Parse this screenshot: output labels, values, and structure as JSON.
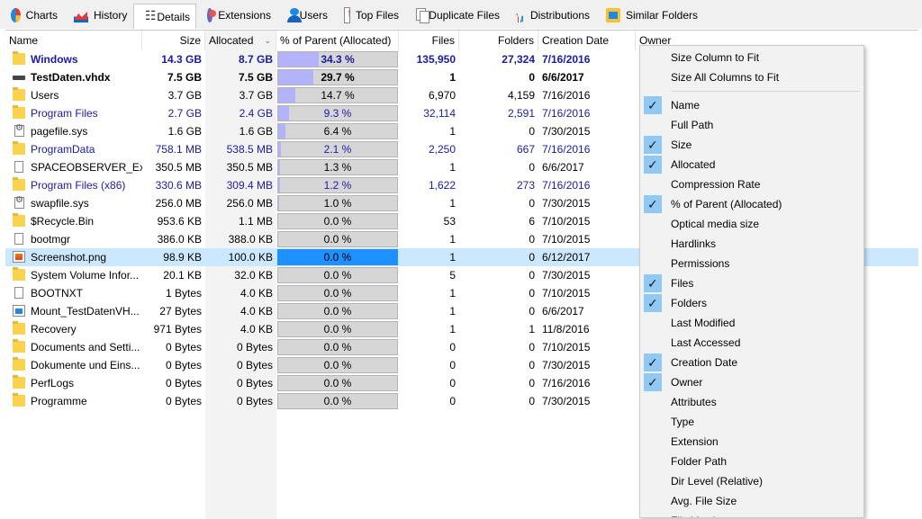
{
  "tabs": [
    {
      "label": "Charts",
      "icon": "pie-chart-icon"
    },
    {
      "label": "History",
      "icon": "history-chart-icon"
    },
    {
      "label": "Details",
      "icon": "details-list-icon",
      "active": true
    },
    {
      "label": "Extensions",
      "icon": "extensions-icon"
    },
    {
      "label": "Users",
      "icon": "users-icon"
    },
    {
      "label": "Top Files",
      "icon": "top-files-icon"
    },
    {
      "label": "Duplicate Files",
      "icon": "duplicate-files-icon"
    },
    {
      "label": "Distributions",
      "icon": "distributions-icon"
    },
    {
      "label": "Similar Folders",
      "icon": "similar-folders-icon"
    }
  ],
  "columns": {
    "name": "Name",
    "size": "Size",
    "allocated": "Allocated",
    "pct": "% of Parent (Allocated)",
    "files": "Files",
    "folders": "Folders",
    "creation": "Creation Date",
    "owner": "Owner"
  },
  "rows": [
    {
      "name": "Windows",
      "size": "14.3 GB",
      "allocated": "8.7 GB",
      "pct": "34.3 %",
      "pct_value": 34.3,
      "files": "135,950",
      "folders": "27,324",
      "creation": "7/16/2016",
      "icon": "folder",
      "style": "bold-blue"
    },
    {
      "name": "TestDaten.vhdx",
      "size": "7.5 GB",
      "allocated": "7.5 GB",
      "pct": "29.7 %",
      "pct_value": 29.7,
      "files": "1",
      "folders": "0",
      "creation": "6/6/2017",
      "icon": "drive",
      "style": "bold"
    },
    {
      "name": "Users",
      "size": "3.7 GB",
      "allocated": "3.7 GB",
      "pct": "14.7 %",
      "pct_value": 14.7,
      "files": "6,970",
      "folders": "4,159",
      "creation": "7/16/2016",
      "icon": "folder",
      "style": "normal"
    },
    {
      "name": "Program Files",
      "size": "2.7 GB",
      "allocated": "2.4 GB",
      "pct": "9.3 %",
      "pct_value": 9.3,
      "files": "32,114",
      "folders": "2,591",
      "creation": "7/16/2016",
      "icon": "folder",
      "style": "blue"
    },
    {
      "name": "pagefile.sys",
      "size": "1.6 GB",
      "allocated": "1.6 GB",
      "pct": "6.4 %",
      "pct_value": 6.4,
      "files": "1",
      "folders": "0",
      "creation": "7/30/2015",
      "icon": "gear",
      "style": "normal"
    },
    {
      "name": "ProgramData",
      "size": "758.1 MB",
      "allocated": "538.5 MB",
      "pct": "2.1 %",
      "pct_value": 2.1,
      "files": "2,250",
      "folders": "667",
      "creation": "7/16/2016",
      "icon": "folder",
      "style": "blue"
    },
    {
      "name": "SPACEOBSERVER_Ex...",
      "size": "350.5 MB",
      "allocated": "350.5 MB",
      "pct": "1.3 %",
      "pct_value": 1.3,
      "files": "1",
      "folders": "0",
      "creation": "6/6/2017",
      "icon": "file",
      "style": "normal"
    },
    {
      "name": "Program Files (x86)",
      "size": "330.6 MB",
      "allocated": "309.4 MB",
      "pct": "1.2 %",
      "pct_value": 1.2,
      "files": "1,622",
      "folders": "273",
      "creation": "7/16/2016",
      "icon": "folder",
      "style": "blue"
    },
    {
      "name": "swapfile.sys",
      "size": "256.0 MB",
      "allocated": "256.0 MB",
      "pct": "1.0 %",
      "pct_value": 1.0,
      "files": "1",
      "folders": "0",
      "creation": "7/30/2015",
      "icon": "gear",
      "style": "normal"
    },
    {
      "name": "$Recycle.Bin",
      "size": "953.6 KB",
      "allocated": "1.1 MB",
      "pct": "0.0 %",
      "pct_value": 0,
      "files": "53",
      "folders": "6",
      "creation": "7/10/2015",
      "icon": "folder",
      "style": "normal"
    },
    {
      "name": "bootmgr",
      "size": "386.0 KB",
      "allocated": "388.0 KB",
      "pct": "0.0 %",
      "pct_value": 0,
      "files": "1",
      "folders": "0",
      "creation": "7/10/2015",
      "icon": "file",
      "style": "normal"
    },
    {
      "name": "Screenshot.png",
      "size": "98.9 KB",
      "allocated": "100.0 KB",
      "pct": "0.0 %",
      "pct_value": 0,
      "files": "1",
      "folders": "0",
      "creation": "6/12/2017",
      "icon": "img",
      "style": "normal",
      "selected": true
    },
    {
      "name": "System Volume Infor...",
      "size": "20.1 KB",
      "allocated": "32.0 KB",
      "pct": "0.0 %",
      "pct_value": 0,
      "files": "5",
      "folders": "0",
      "creation": "7/30/2015",
      "icon": "folder",
      "style": "normal"
    },
    {
      "name": "BOOTNXT",
      "size": "1 Bytes",
      "allocated": "4.0 KB",
      "pct": "0.0 %",
      "pct_value": 0,
      "files": "1",
      "folders": "0",
      "creation": "7/10/2015",
      "icon": "file",
      "style": "normal"
    },
    {
      "name": "Mount_TestDatenVH...",
      "size": "27 Bytes",
      "allocated": "4.0 KB",
      "pct": "0.0 %",
      "pct_value": 0,
      "files": "1",
      "folders": "0",
      "creation": "6/6/2017",
      "icon": "mount",
      "style": "normal"
    },
    {
      "name": "Recovery",
      "size": "971 Bytes",
      "allocated": "4.0 KB",
      "pct": "0.0 %",
      "pct_value": 0,
      "files": "1",
      "folders": "1",
      "creation": "11/8/2016",
      "icon": "folder",
      "style": "normal"
    },
    {
      "name": "Documents and Setti...",
      "size": "0 Bytes",
      "allocated": "0 Bytes",
      "pct": "0.0 %",
      "pct_value": 0,
      "files": "0",
      "folders": "0",
      "creation": "7/10/2015",
      "icon": "folder",
      "style": "normal"
    },
    {
      "name": "Dokumente und Eins...",
      "size": "0 Bytes",
      "allocated": "0 Bytes",
      "pct": "0.0 %",
      "pct_value": 0,
      "files": "0",
      "folders": "0",
      "creation": "7/30/2015",
      "icon": "folder",
      "style": "normal"
    },
    {
      "name": "PerfLogs",
      "size": "0 Bytes",
      "allocated": "0 Bytes",
      "pct": "0.0 %",
      "pct_value": 0,
      "files": "0",
      "folders": "0",
      "creation": "7/16/2016",
      "icon": "folder",
      "style": "normal"
    },
    {
      "name": "Programme",
      "size": "0 Bytes",
      "allocated": "0 Bytes",
      "pct": "0.0 %",
      "pct_value": 0,
      "files": "0",
      "folders": "0",
      "creation": "7/30/2015",
      "icon": "folder",
      "style": "normal"
    }
  ],
  "context_menu": {
    "top_items": [
      {
        "label": "Size Column to Fit"
      },
      {
        "label": "Size All Columns to Fit"
      }
    ],
    "column_items": [
      {
        "label": "Name",
        "checked": true
      },
      {
        "label": "Full Path",
        "checked": false
      },
      {
        "label": "Size",
        "checked": true
      },
      {
        "label": "Allocated",
        "checked": true
      },
      {
        "label": "Compression Rate",
        "checked": false
      },
      {
        "label": "% of Parent (Allocated)",
        "checked": true
      },
      {
        "label": "Optical media size",
        "checked": false
      },
      {
        "label": "Hardlinks",
        "checked": false
      },
      {
        "label": "Permissions",
        "checked": false
      },
      {
        "label": "Files",
        "checked": true
      },
      {
        "label": "Folders",
        "checked": true
      },
      {
        "label": "Last Modified",
        "checked": false
      },
      {
        "label": "Last Accessed",
        "checked": false
      },
      {
        "label": "Creation Date",
        "checked": true
      },
      {
        "label": "Owner",
        "checked": true
      },
      {
        "label": "Attributes",
        "checked": false
      },
      {
        "label": "Type",
        "checked": false
      },
      {
        "label": "Extension",
        "checked": false
      },
      {
        "label": "Folder Path",
        "checked": false
      },
      {
        "label": "Dir Level (Relative)",
        "checked": false
      },
      {
        "label": "Avg. File Size",
        "checked": false
      },
      {
        "label": "File Version",
        "checked": false
      }
    ]
  },
  "colors": {
    "blue_text": "#1a1aa6",
    "bar_fill": "#b3b3fb",
    "selection": "#cce8ff",
    "selected_bar": "#1e90ff"
  }
}
